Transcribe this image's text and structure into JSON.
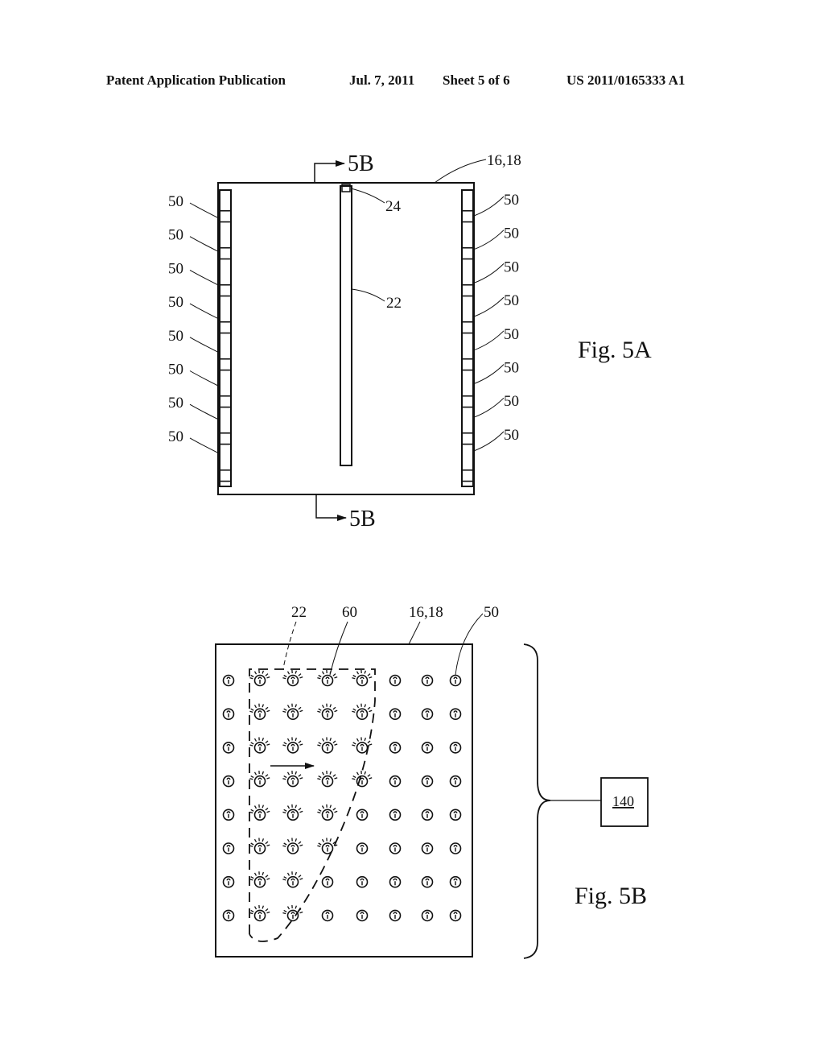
{
  "header": {
    "publication": "Patent Application Publication",
    "date": "Jul. 7, 2011",
    "sheet": "Sheet 5 of 6",
    "number": "US 2011/0165333 A1"
  },
  "fig5a": {
    "caption": "Fig. 5A",
    "section_label_top": "5B",
    "section_label_bottom": "5B",
    "housing_ref": "16,18",
    "bar_ref": "22",
    "tip_ref": "24",
    "left_refs": [
      "50",
      "50",
      "50",
      "50",
      "50",
      "50",
      "50",
      "50"
    ],
    "right_refs": [
      "50",
      "50",
      "50",
      "50",
      "50",
      "50",
      "50",
      "50"
    ]
  },
  "fig5b": {
    "caption": "Fig. 5B",
    "ref_22": "22",
    "ref_60": "60",
    "ref_housing": "16,18",
    "ref_50": "50",
    "controller_ref": "140",
    "grid": {
      "rows": 8,
      "cols": 8,
      "lit": [
        [
          0,
          1,
          1,
          1,
          1,
          0,
          0,
          0
        ],
        [
          0,
          1,
          1,
          1,
          1,
          0,
          0,
          0
        ],
        [
          0,
          1,
          1,
          1,
          1,
          0,
          0,
          0
        ],
        [
          0,
          1,
          1,
          1,
          1,
          0,
          0,
          0
        ],
        [
          0,
          1,
          1,
          1,
          0,
          0,
          0,
          0
        ],
        [
          0,
          1,
          1,
          1,
          0,
          0,
          0,
          0
        ],
        [
          0,
          1,
          1,
          0,
          0,
          0,
          0,
          0
        ],
        [
          0,
          1,
          1,
          0,
          0,
          0,
          0,
          0
        ]
      ]
    }
  }
}
